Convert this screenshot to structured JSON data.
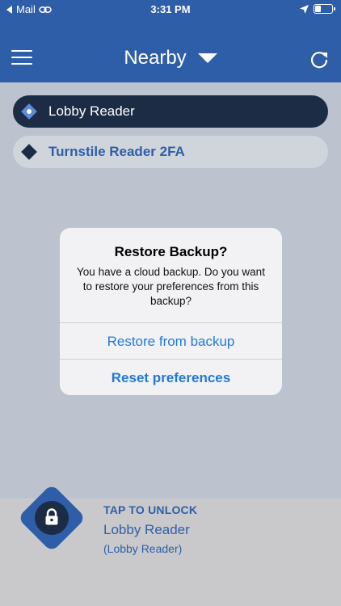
{
  "status_bar": {
    "back_app": "Mail",
    "time": "3:31 PM",
    "battery_level": 0.35
  },
  "nav": {
    "title": "Nearby"
  },
  "readers": [
    {
      "label": "Lobby Reader",
      "selected": true
    },
    {
      "label": "Turnstile Reader 2FA",
      "selected": false
    }
  ],
  "dialog": {
    "title": "Restore Backup?",
    "message": "You have a cloud backup. Do you want to restore your preferences from this backup?",
    "restore_label": "Restore from backup",
    "reset_label": "Reset preferences"
  },
  "unlock": {
    "tap_label": "TAP TO UNLOCK",
    "reader_name": "Lobby Reader",
    "reader_sub": "(Lobby Reader)"
  },
  "colors": {
    "primary": "#2f5ea8",
    "dark": "#1c2c45",
    "link": "#1f7ad8"
  },
  "icons": {
    "back": "back-arrow-icon",
    "link": "link-icon",
    "location": "location-arrow-icon",
    "battery": "battery-icon",
    "menu": "menu-icon",
    "dropdown": "chevron-down-icon",
    "refresh": "refresh-icon",
    "lock": "lock-icon"
  }
}
